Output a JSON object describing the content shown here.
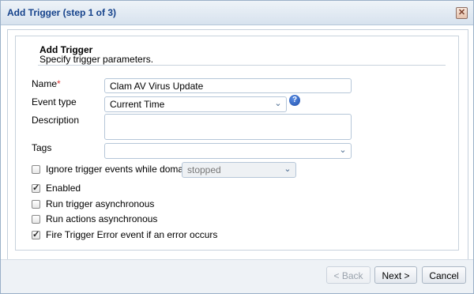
{
  "dialog": {
    "title": "Add Trigger (step 1 of 3)"
  },
  "header": {
    "title": "Add Trigger",
    "subtitle": "Specify trigger parameters."
  },
  "form": {
    "name_label": "Name",
    "name_required_mark": "*",
    "name_value": "Clam AV Virus Update",
    "event_type_label": "Event type",
    "event_type_value": "Current Time",
    "description_label": "Description",
    "description_value": "",
    "tags_label": "Tags",
    "tags_value": "",
    "ignore_label": "Ignore trigger events while domain is",
    "ignore_checked": false,
    "ignore_state_value": "stopped",
    "enabled_label": "Enabled",
    "enabled_checked": true,
    "run_trigger_async_label": "Run trigger asynchronous",
    "run_trigger_async_checked": false,
    "run_actions_async_label": "Run actions asynchronous",
    "run_actions_async_checked": false,
    "fire_error_label": "Fire Trigger Error event if an error occurs",
    "fire_error_checked": true
  },
  "buttons": {
    "back": "< Back",
    "next": "Next >",
    "cancel": "Cancel"
  },
  "icons": {
    "close": "close-icon",
    "help": "help-icon",
    "chevron": "chevron-down-icon",
    "check": "check-icon"
  },
  "colors": {
    "title_text": "#15428b",
    "required_mark": "#dd3333",
    "help_icon": "#1f4ea8"
  }
}
